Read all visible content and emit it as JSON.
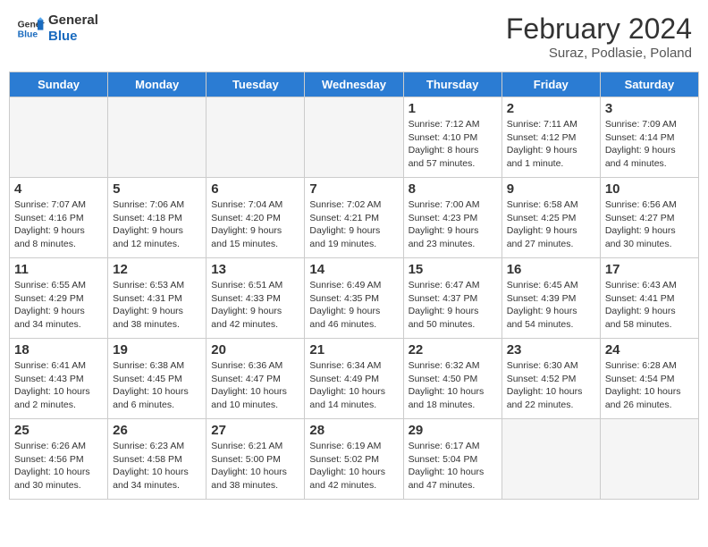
{
  "header": {
    "logo_general": "General",
    "logo_blue": "Blue",
    "month_title": "February 2024",
    "location": "Suraz, Podlasie, Poland"
  },
  "weekdays": [
    "Sunday",
    "Monday",
    "Tuesday",
    "Wednesday",
    "Thursday",
    "Friday",
    "Saturday"
  ],
  "weeks": [
    [
      {
        "day": "",
        "sunrise": "",
        "sunset": "",
        "daylight": "",
        "empty": true
      },
      {
        "day": "",
        "sunrise": "",
        "sunset": "",
        "daylight": "",
        "empty": true
      },
      {
        "day": "",
        "sunrise": "",
        "sunset": "",
        "daylight": "",
        "empty": true
      },
      {
        "day": "",
        "sunrise": "",
        "sunset": "",
        "daylight": "",
        "empty": true
      },
      {
        "day": "1",
        "sunrise": "Sunrise: 7:12 AM",
        "sunset": "Sunset: 4:10 PM",
        "daylight": "Daylight: 8 hours and 57 minutes.",
        "empty": false
      },
      {
        "day": "2",
        "sunrise": "Sunrise: 7:11 AM",
        "sunset": "Sunset: 4:12 PM",
        "daylight": "Daylight: 9 hours and 1 minute.",
        "empty": false
      },
      {
        "day": "3",
        "sunrise": "Sunrise: 7:09 AM",
        "sunset": "Sunset: 4:14 PM",
        "daylight": "Daylight: 9 hours and 4 minutes.",
        "empty": false
      }
    ],
    [
      {
        "day": "4",
        "sunrise": "Sunrise: 7:07 AM",
        "sunset": "Sunset: 4:16 PM",
        "daylight": "Daylight: 9 hours and 8 minutes.",
        "empty": false
      },
      {
        "day": "5",
        "sunrise": "Sunrise: 7:06 AM",
        "sunset": "Sunset: 4:18 PM",
        "daylight": "Daylight: 9 hours and 12 minutes.",
        "empty": false
      },
      {
        "day": "6",
        "sunrise": "Sunrise: 7:04 AM",
        "sunset": "Sunset: 4:20 PM",
        "daylight": "Daylight: 9 hours and 15 minutes.",
        "empty": false
      },
      {
        "day": "7",
        "sunrise": "Sunrise: 7:02 AM",
        "sunset": "Sunset: 4:21 PM",
        "daylight": "Daylight: 9 hours and 19 minutes.",
        "empty": false
      },
      {
        "day": "8",
        "sunrise": "Sunrise: 7:00 AM",
        "sunset": "Sunset: 4:23 PM",
        "daylight": "Daylight: 9 hours and 23 minutes.",
        "empty": false
      },
      {
        "day": "9",
        "sunrise": "Sunrise: 6:58 AM",
        "sunset": "Sunset: 4:25 PM",
        "daylight": "Daylight: 9 hours and 27 minutes.",
        "empty": false
      },
      {
        "day": "10",
        "sunrise": "Sunrise: 6:56 AM",
        "sunset": "Sunset: 4:27 PM",
        "daylight": "Daylight: 9 hours and 30 minutes.",
        "empty": false
      }
    ],
    [
      {
        "day": "11",
        "sunrise": "Sunrise: 6:55 AM",
        "sunset": "Sunset: 4:29 PM",
        "daylight": "Daylight: 9 hours and 34 minutes.",
        "empty": false
      },
      {
        "day": "12",
        "sunrise": "Sunrise: 6:53 AM",
        "sunset": "Sunset: 4:31 PM",
        "daylight": "Daylight: 9 hours and 38 minutes.",
        "empty": false
      },
      {
        "day": "13",
        "sunrise": "Sunrise: 6:51 AM",
        "sunset": "Sunset: 4:33 PM",
        "daylight": "Daylight: 9 hours and 42 minutes.",
        "empty": false
      },
      {
        "day": "14",
        "sunrise": "Sunrise: 6:49 AM",
        "sunset": "Sunset: 4:35 PM",
        "daylight": "Daylight: 9 hours and 46 minutes.",
        "empty": false
      },
      {
        "day": "15",
        "sunrise": "Sunrise: 6:47 AM",
        "sunset": "Sunset: 4:37 PM",
        "daylight": "Daylight: 9 hours and 50 minutes.",
        "empty": false
      },
      {
        "day": "16",
        "sunrise": "Sunrise: 6:45 AM",
        "sunset": "Sunset: 4:39 PM",
        "daylight": "Daylight: 9 hours and 54 minutes.",
        "empty": false
      },
      {
        "day": "17",
        "sunrise": "Sunrise: 6:43 AM",
        "sunset": "Sunset: 4:41 PM",
        "daylight": "Daylight: 9 hours and 58 minutes.",
        "empty": false
      }
    ],
    [
      {
        "day": "18",
        "sunrise": "Sunrise: 6:41 AM",
        "sunset": "Sunset: 4:43 PM",
        "daylight": "Daylight: 10 hours and 2 minutes.",
        "empty": false
      },
      {
        "day": "19",
        "sunrise": "Sunrise: 6:38 AM",
        "sunset": "Sunset: 4:45 PM",
        "daylight": "Daylight: 10 hours and 6 minutes.",
        "empty": false
      },
      {
        "day": "20",
        "sunrise": "Sunrise: 6:36 AM",
        "sunset": "Sunset: 4:47 PM",
        "daylight": "Daylight: 10 hours and 10 minutes.",
        "empty": false
      },
      {
        "day": "21",
        "sunrise": "Sunrise: 6:34 AM",
        "sunset": "Sunset: 4:49 PM",
        "daylight": "Daylight: 10 hours and 14 minutes.",
        "empty": false
      },
      {
        "day": "22",
        "sunrise": "Sunrise: 6:32 AM",
        "sunset": "Sunset: 4:50 PM",
        "daylight": "Daylight: 10 hours and 18 minutes.",
        "empty": false
      },
      {
        "day": "23",
        "sunrise": "Sunrise: 6:30 AM",
        "sunset": "Sunset: 4:52 PM",
        "daylight": "Daylight: 10 hours and 22 minutes.",
        "empty": false
      },
      {
        "day": "24",
        "sunrise": "Sunrise: 6:28 AM",
        "sunset": "Sunset: 4:54 PM",
        "daylight": "Daylight: 10 hours and 26 minutes.",
        "empty": false
      }
    ],
    [
      {
        "day": "25",
        "sunrise": "Sunrise: 6:26 AM",
        "sunset": "Sunset: 4:56 PM",
        "daylight": "Daylight: 10 hours and 30 minutes.",
        "empty": false
      },
      {
        "day": "26",
        "sunrise": "Sunrise: 6:23 AM",
        "sunset": "Sunset: 4:58 PM",
        "daylight": "Daylight: 10 hours and 34 minutes.",
        "empty": false
      },
      {
        "day": "27",
        "sunrise": "Sunrise: 6:21 AM",
        "sunset": "Sunset: 5:00 PM",
        "daylight": "Daylight: 10 hours and 38 minutes.",
        "empty": false
      },
      {
        "day": "28",
        "sunrise": "Sunrise: 6:19 AM",
        "sunset": "Sunset: 5:02 PM",
        "daylight": "Daylight: 10 hours and 42 minutes.",
        "empty": false
      },
      {
        "day": "29",
        "sunrise": "Sunrise: 6:17 AM",
        "sunset": "Sunset: 5:04 PM",
        "daylight": "Daylight: 10 hours and 47 minutes.",
        "empty": false
      },
      {
        "day": "",
        "sunrise": "",
        "sunset": "",
        "daylight": "",
        "empty": true
      },
      {
        "day": "",
        "sunrise": "",
        "sunset": "",
        "daylight": "",
        "empty": true
      }
    ]
  ]
}
